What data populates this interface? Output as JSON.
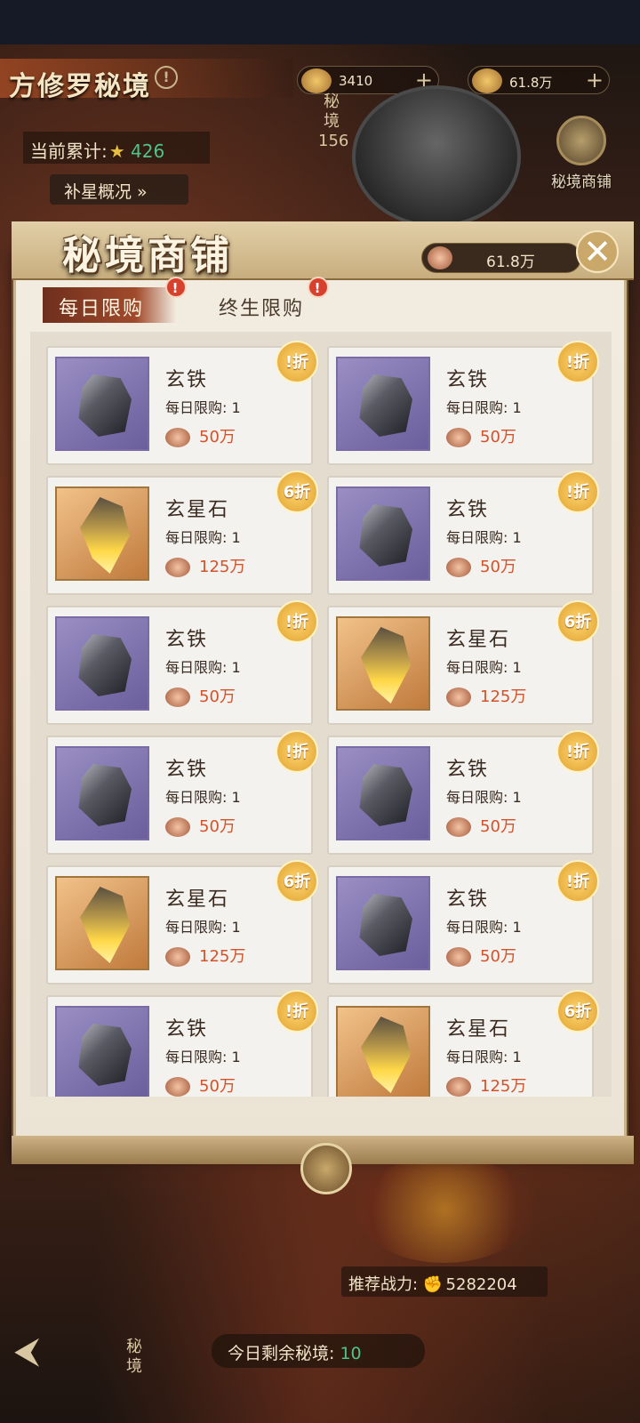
{
  "hud": {
    "title": "方修罗秘境",
    "help_icon": "!",
    "gold_value": "3410",
    "coin_value": "61.8万",
    "plus": "+",
    "tally_label": "当前累计:",
    "tally_star": "★",
    "tally_value": "426",
    "stars_button": "补星概况 »",
    "portrait_label": "秘境156",
    "shop_button": "秘境商铺"
  },
  "dialog": {
    "title": "秘境商铺",
    "currency_value": "61.8万",
    "close": "✕",
    "tabs": [
      {
        "label": "每日限购",
        "badge": "!"
      },
      {
        "label": "终生限购",
        "badge": "!"
      }
    ]
  },
  "items": [
    {
      "name": "玄铁",
      "limit": "每日限购: 1",
      "price": "50万",
      "discount": "!折",
      "type": "iron"
    },
    {
      "name": "玄铁",
      "limit": "每日限购: 1",
      "price": "50万",
      "discount": "!折",
      "type": "iron"
    },
    {
      "name": "玄星石",
      "limit": "每日限购: 1",
      "price": "125万",
      "discount": "6折",
      "type": "star"
    },
    {
      "name": "玄铁",
      "limit": "每日限购: 1",
      "price": "50万",
      "discount": "!折",
      "type": "iron"
    },
    {
      "name": "玄铁",
      "limit": "每日限购: 1",
      "price": "50万",
      "discount": "!折",
      "type": "iron"
    },
    {
      "name": "玄星石",
      "limit": "每日限购: 1",
      "price": "125万",
      "discount": "6折",
      "type": "star"
    },
    {
      "name": "玄铁",
      "limit": "每日限购: 1",
      "price": "50万",
      "discount": "!折",
      "type": "iron"
    },
    {
      "name": "玄铁",
      "limit": "每日限购: 1",
      "price": "50万",
      "discount": "!折",
      "type": "iron"
    },
    {
      "name": "玄星石",
      "limit": "每日限购: 1",
      "price": "125万",
      "discount": "6折",
      "type": "star"
    },
    {
      "name": "玄铁",
      "limit": "每日限购: 1",
      "price": "50万",
      "discount": "!折",
      "type": "iron"
    },
    {
      "name": "玄铁",
      "limit": "每日限购: 1",
      "price": "50万",
      "discount": "!折",
      "type": "iron"
    },
    {
      "name": "玄星石",
      "limit": "每日限购: 1",
      "price": "125万",
      "discount": "6折",
      "type": "star"
    }
  ],
  "bottom": {
    "power_label": "推荐战力:",
    "power_value": "5282204",
    "remaining_label": "今日剩余秘境:",
    "remaining_value": "10",
    "side_label": "秘境"
  },
  "colors": {
    "accent_tab": "#a14a2c",
    "price": "#d2522a",
    "discount": "#e0a030",
    "green_value": "#4ec48a"
  }
}
